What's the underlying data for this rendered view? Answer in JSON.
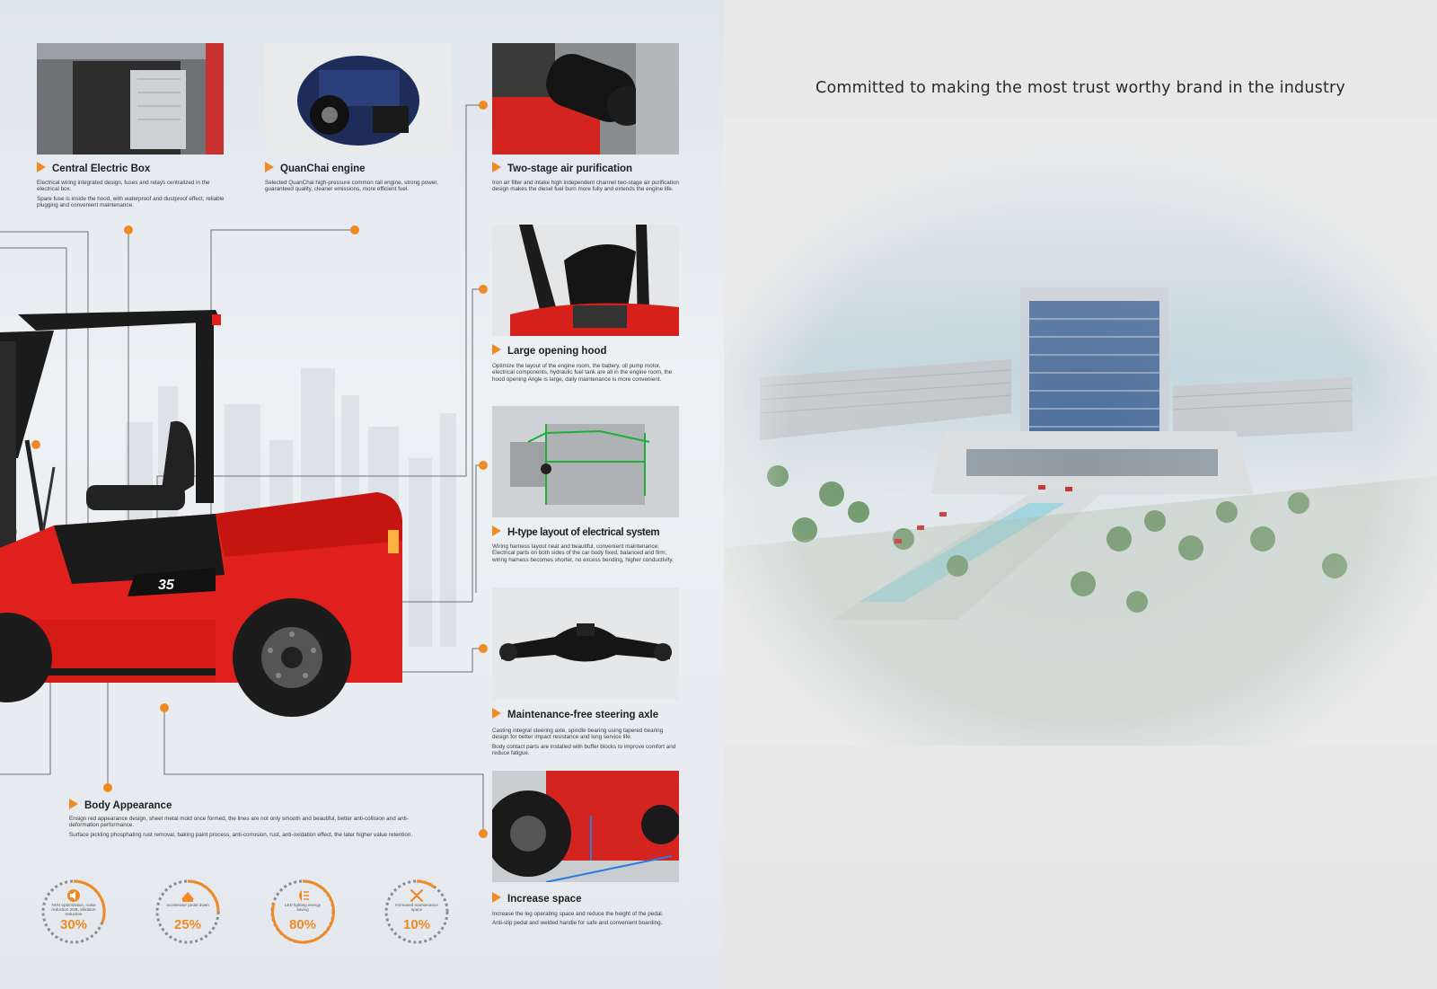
{
  "tagline": "Committed to making the most trust worthy brand in the industry",
  "accent_color": "#f08a24",
  "features": [
    {
      "id": "central-electric-box",
      "title": "Central Electric Box",
      "paragraphs": [
        "Electrical wiring integrated design, fuses and relays centralized in the electrical box.",
        "Spare fuse is inside the hood, with waterproof and dustproof effect, reliable plugging and convenient maintenance."
      ],
      "icon": "electric-box-photo"
    },
    {
      "id": "quanchai-engine",
      "title": "QuanChai  engine",
      "paragraphs": [
        "Selected QuanChai high-pressure common rail engine, strong power, guaranteed quality, cleaner emissions, more efficient fuel."
      ],
      "icon": "engine-photo"
    },
    {
      "id": "two-stage-air-purification",
      "title": "Two-stage air purification",
      "paragraphs": [
        "Iron air filter and intake high independent channel two-stage air purification design makes the diesel fuel burn more fully and extends the engine life."
      ],
      "icon": "air-filter-photo"
    },
    {
      "id": "large-opening-hood",
      "title": "Large opening hood",
      "paragraphs": [
        "Optimize the layout of the engine room, the battery, oil pump motor, electrical components, hydraulic fuel tank are all in the engine room, the hood opening Angle is large, daily maintenance is more convenient."
      ],
      "icon": "hood-photo"
    },
    {
      "id": "h-type-layout",
      "title": "H-type layout of electrical system",
      "paragraphs": [
        "Wiring harness layout neat and beautiful, convenient maintenance; Electrical parts on both sides of the car body fixed, balanced and firm; wiring harness becomes shorter, no excess bending, higher conductivity."
      ],
      "icon": "wiring-layout-photo"
    },
    {
      "id": "steering-axle",
      "title": "Maintenance-free steering axle",
      "paragraphs": [
        "Casting integral steering axle, spindle bearing using tapered bearing design for better impact resistance and long service life.",
        "Body contact parts are installed with buffer blocks to improve comfort and reduce fatigue."
      ],
      "icon": "steering-axle-photo"
    },
    {
      "id": "increase-space",
      "title": "Increase space",
      "paragraphs": [
        "Increase the leg operating space and reduce the height of the pedal.",
        "Anti-slip pedal and welded handle for safe and convenient boarding."
      ],
      "icon": "operator-space-photo"
    },
    {
      "id": "body-appearance",
      "title": "Body Appearance",
      "paragraphs": [
        "Ensign red appearance design, sheet metal mold once formed, the lines are not only smooth and beautiful, better anti-collision and anti-deformation performance.",
        "Surface pickling phosphating rust removal, baking paint process, anti-corrosion, rust, anti-oxidation effect, the later higher value retention."
      ],
      "icon": ""
    }
  ],
  "stats": [
    {
      "label": "NVH optimization, noise reduction 2DB, vibration reduction",
      "value": "30%",
      "icon": "speaker-icon",
      "progress": 0.3
    },
    {
      "label": "accelerator pedal down",
      "value": "25%",
      "icon": "pedal-icon",
      "progress": 0.25
    },
    {
      "label": "LED lighting energy saving",
      "value": "80%",
      "icon": "headlight-icon",
      "progress": 0.8
    },
    {
      "label": "Increased maintenance space",
      "value": "10%",
      "icon": "wrench-icon",
      "progress": 0.1
    }
  ],
  "forklift": {
    "model_badge": "35",
    "color": "#e0201c"
  },
  "images": {
    "campus": "headquarters-campus-aerial-photo"
  }
}
